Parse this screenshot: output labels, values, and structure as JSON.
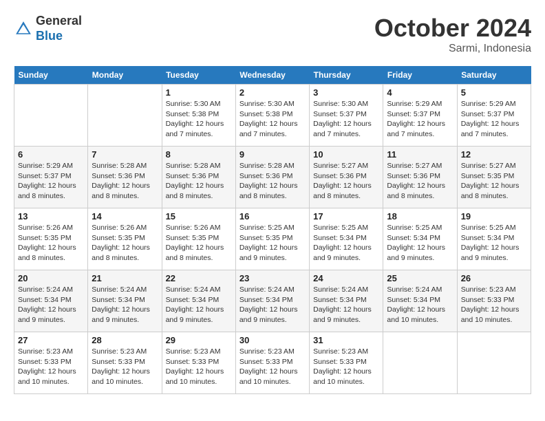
{
  "header": {
    "logo_general": "General",
    "logo_blue": "Blue",
    "month_year": "October 2024",
    "location": "Sarmi, Indonesia"
  },
  "weekdays": [
    "Sunday",
    "Monday",
    "Tuesday",
    "Wednesday",
    "Thursday",
    "Friday",
    "Saturday"
  ],
  "weeks": [
    [
      {
        "day": "",
        "info": ""
      },
      {
        "day": "",
        "info": ""
      },
      {
        "day": "1",
        "info": "Sunrise: 5:30 AM\nSunset: 5:38 PM\nDaylight: 12 hours and 7 minutes."
      },
      {
        "day": "2",
        "info": "Sunrise: 5:30 AM\nSunset: 5:38 PM\nDaylight: 12 hours and 7 minutes."
      },
      {
        "day": "3",
        "info": "Sunrise: 5:30 AM\nSunset: 5:37 PM\nDaylight: 12 hours and 7 minutes."
      },
      {
        "day": "4",
        "info": "Sunrise: 5:29 AM\nSunset: 5:37 PM\nDaylight: 12 hours and 7 minutes."
      },
      {
        "day": "5",
        "info": "Sunrise: 5:29 AM\nSunset: 5:37 PM\nDaylight: 12 hours and 7 minutes."
      }
    ],
    [
      {
        "day": "6",
        "info": "Sunrise: 5:29 AM\nSunset: 5:37 PM\nDaylight: 12 hours and 8 minutes."
      },
      {
        "day": "7",
        "info": "Sunrise: 5:28 AM\nSunset: 5:36 PM\nDaylight: 12 hours and 8 minutes."
      },
      {
        "day": "8",
        "info": "Sunrise: 5:28 AM\nSunset: 5:36 PM\nDaylight: 12 hours and 8 minutes."
      },
      {
        "day": "9",
        "info": "Sunrise: 5:28 AM\nSunset: 5:36 PM\nDaylight: 12 hours and 8 minutes."
      },
      {
        "day": "10",
        "info": "Sunrise: 5:27 AM\nSunset: 5:36 PM\nDaylight: 12 hours and 8 minutes."
      },
      {
        "day": "11",
        "info": "Sunrise: 5:27 AM\nSunset: 5:36 PM\nDaylight: 12 hours and 8 minutes."
      },
      {
        "day": "12",
        "info": "Sunrise: 5:27 AM\nSunset: 5:35 PM\nDaylight: 12 hours and 8 minutes."
      }
    ],
    [
      {
        "day": "13",
        "info": "Sunrise: 5:26 AM\nSunset: 5:35 PM\nDaylight: 12 hours and 8 minutes."
      },
      {
        "day": "14",
        "info": "Sunrise: 5:26 AM\nSunset: 5:35 PM\nDaylight: 12 hours and 8 minutes."
      },
      {
        "day": "15",
        "info": "Sunrise: 5:26 AM\nSunset: 5:35 PM\nDaylight: 12 hours and 8 minutes."
      },
      {
        "day": "16",
        "info": "Sunrise: 5:25 AM\nSunset: 5:35 PM\nDaylight: 12 hours and 9 minutes."
      },
      {
        "day": "17",
        "info": "Sunrise: 5:25 AM\nSunset: 5:34 PM\nDaylight: 12 hours and 9 minutes."
      },
      {
        "day": "18",
        "info": "Sunrise: 5:25 AM\nSunset: 5:34 PM\nDaylight: 12 hours and 9 minutes."
      },
      {
        "day": "19",
        "info": "Sunrise: 5:25 AM\nSunset: 5:34 PM\nDaylight: 12 hours and 9 minutes."
      }
    ],
    [
      {
        "day": "20",
        "info": "Sunrise: 5:24 AM\nSunset: 5:34 PM\nDaylight: 12 hours and 9 minutes."
      },
      {
        "day": "21",
        "info": "Sunrise: 5:24 AM\nSunset: 5:34 PM\nDaylight: 12 hours and 9 minutes."
      },
      {
        "day": "22",
        "info": "Sunrise: 5:24 AM\nSunset: 5:34 PM\nDaylight: 12 hours and 9 minutes."
      },
      {
        "day": "23",
        "info": "Sunrise: 5:24 AM\nSunset: 5:34 PM\nDaylight: 12 hours and 9 minutes."
      },
      {
        "day": "24",
        "info": "Sunrise: 5:24 AM\nSunset: 5:34 PM\nDaylight: 12 hours and 9 minutes."
      },
      {
        "day": "25",
        "info": "Sunrise: 5:24 AM\nSunset: 5:34 PM\nDaylight: 12 hours and 10 minutes."
      },
      {
        "day": "26",
        "info": "Sunrise: 5:23 AM\nSunset: 5:33 PM\nDaylight: 12 hours and 10 minutes."
      }
    ],
    [
      {
        "day": "27",
        "info": "Sunrise: 5:23 AM\nSunset: 5:33 PM\nDaylight: 12 hours and 10 minutes."
      },
      {
        "day": "28",
        "info": "Sunrise: 5:23 AM\nSunset: 5:33 PM\nDaylight: 12 hours and 10 minutes."
      },
      {
        "day": "29",
        "info": "Sunrise: 5:23 AM\nSunset: 5:33 PM\nDaylight: 12 hours and 10 minutes."
      },
      {
        "day": "30",
        "info": "Sunrise: 5:23 AM\nSunset: 5:33 PM\nDaylight: 12 hours and 10 minutes."
      },
      {
        "day": "31",
        "info": "Sunrise: 5:23 AM\nSunset: 5:33 PM\nDaylight: 12 hours and 10 minutes."
      },
      {
        "day": "",
        "info": ""
      },
      {
        "day": "",
        "info": ""
      }
    ]
  ]
}
